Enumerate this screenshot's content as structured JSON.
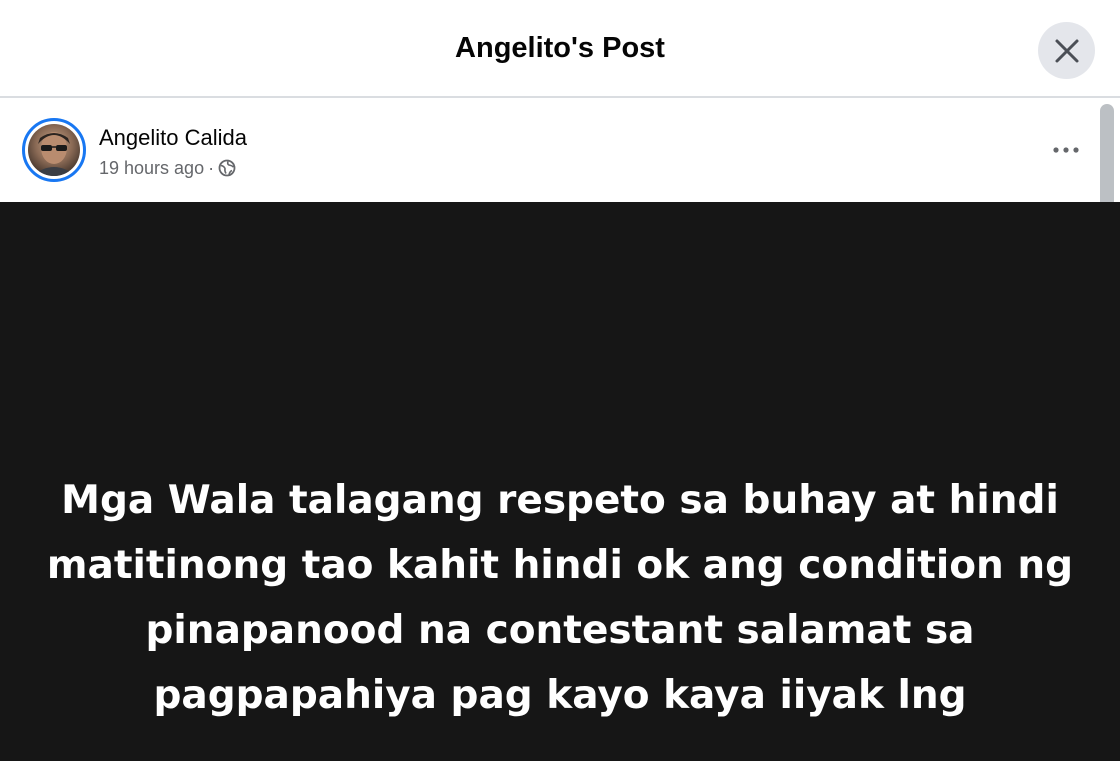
{
  "dialog": {
    "title": "Angelito's Post",
    "close_icon": "close-icon"
  },
  "post": {
    "author": "Angelito Calida",
    "time": "19 hours ago",
    "separator": "·",
    "privacy_icon": "globe-icon",
    "more_icon": "more-options-icon",
    "text": "Mga Wala talagang respeto sa buhay at hindi matitinong tao kahit hindi ok ang condition ng pinapanood na contestant salamat sa pagpapahiya pag kayo kaya iiyak lng"
  },
  "colors": {
    "story_ring": "#1877f2",
    "post_background": "#161616",
    "post_text": "#ffffff",
    "meta_text": "#65676b"
  }
}
